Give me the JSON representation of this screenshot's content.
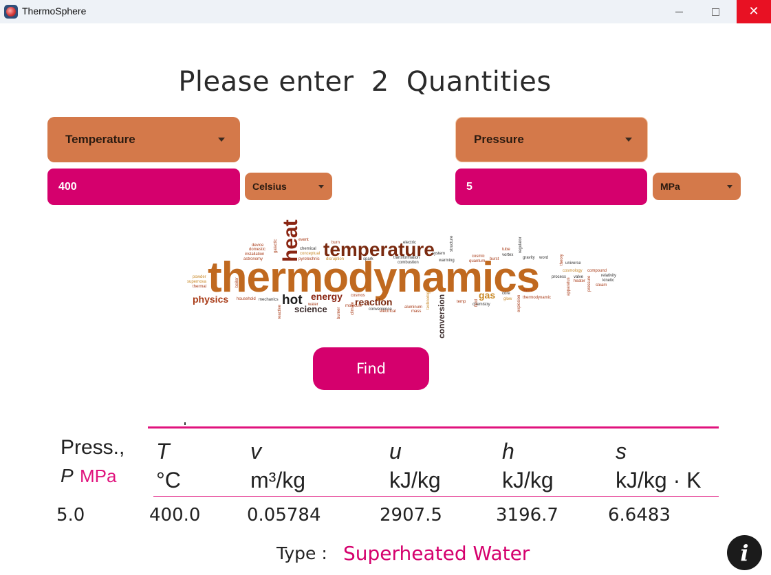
{
  "window": {
    "title": "ThermoSphere",
    "icon": "thermosphere-app-icon",
    "close_glyph": "✕"
  },
  "heading": {
    "prefix": "Please enter",
    "count": "2",
    "suffix": "Quantities"
  },
  "quantity_1": {
    "selected": "Temperature",
    "value": "400",
    "unit": "Celsius"
  },
  "quantity_2": {
    "selected": "Pressure",
    "value": "5",
    "unit": "MPa"
  },
  "wordcloud": {
    "words": [
      "thermodynamics",
      "temperature",
      "heat",
      "hot",
      "energy",
      "physics",
      "science",
      "reaction",
      "gas",
      "conversion",
      "household",
      "mechanics",
      "chemistry",
      "universe",
      "relativity",
      "kinetic",
      "cosmology",
      "compound",
      "theory",
      "vortex",
      "gravity",
      "word",
      "electric",
      "burn",
      "event",
      "chemical",
      "system",
      "warming",
      "cosmic",
      "quantum",
      "burst",
      "tube",
      "regulator",
      "device",
      "domestic",
      "installation",
      "astronomy",
      "pyrotechnic",
      "disruption",
      "spark",
      "transformation",
      "combustion",
      "structure",
      "powder",
      "supernova",
      "thermal",
      "water",
      "cosmos",
      "convenience",
      "aluminum",
      "mass",
      "temp",
      "core",
      "glow",
      "explosion",
      "thermodynamic",
      "valve",
      "heater",
      "pressure",
      "apparatus",
      "boiler",
      "reactive",
      "burner",
      "molecule",
      "climate",
      "electrical",
      "technology",
      "fluid",
      "galactic",
      "conceptual",
      "process",
      "flame",
      "steam"
    ]
  },
  "find_button": "Find",
  "results": {
    "press_label": "Press.,",
    "p_symbol": "P",
    "p_unit": "MPa",
    "columns": [
      {
        "symbol": "T",
        "unit": "°C"
      },
      {
        "symbol": "v",
        "unit": "m³/kg"
      },
      {
        "symbol": "u",
        "unit": "kJ/kg"
      },
      {
        "symbol": "h",
        "unit": "kJ/kg"
      },
      {
        "symbol": "s",
        "unit": "kJ/kg · K"
      }
    ],
    "row": {
      "P": "5.0",
      "T": "400.0",
      "v": "0.05784",
      "u": "2907.5",
      "h": "3196.7",
      "s": "6.6483"
    }
  },
  "type_label": "Type :",
  "type_value": "Superheated Water",
  "colors": {
    "accent_pink": "#d5006d",
    "orange": "#d4794a",
    "close_red": "#e81123"
  },
  "info_icon": "info-icon"
}
